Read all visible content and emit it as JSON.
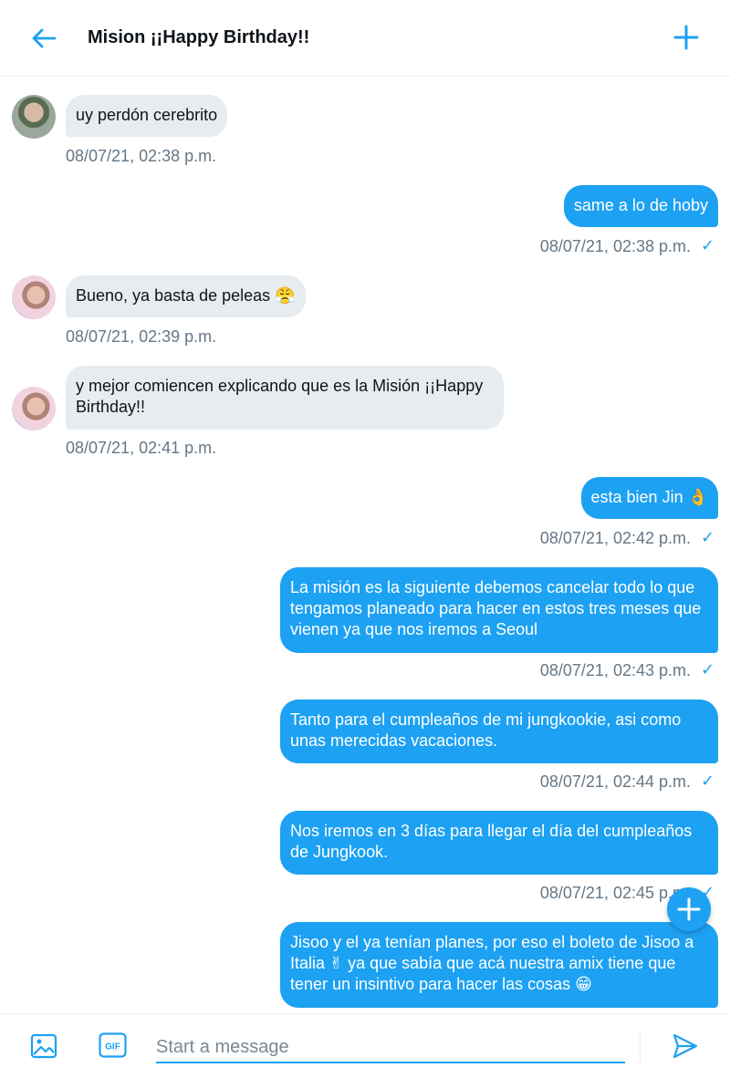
{
  "header": {
    "title": "Mision ¡¡Happy Birthday!!"
  },
  "messages": [
    {
      "text": "uy perdón cerebrito",
      "time": "08/07/21, 02:38 p.m."
    },
    {
      "text": "same a lo de hoby",
      "time": "08/07/21, 02:38 p.m."
    },
    {
      "text": "Bueno, ya basta de peleas 😤",
      "time": "08/07/21, 02:39 p.m."
    },
    {
      "text": "y mejor comiencen explicando que es la Misión ¡¡Happy Birthday!!",
      "time": "08/07/21, 02:41 p.m."
    },
    {
      "text": "esta bien Jin 👌",
      "time": "08/07/21, 02:42 p.m."
    },
    {
      "text": "La misión es la siguiente debemos cancelar todo lo que tengamos planeado para hacer en estos tres meses que vienen ya que nos iremos a Seoul",
      "time": "08/07/21, 02:43 p.m."
    },
    {
      "text": "Tanto para el cumpleaños de mi jungkookie, asi como unas merecidas vacaciones.",
      "time": "08/07/21, 02:44 p.m."
    },
    {
      "text": "Nos iremos en 3 días para llegar el día del cumpleaños de Jungkook.",
      "time": "08/07/21, 02:45 p.m."
    },
    {
      "text": "Jisoo y el ya tenían planes, por eso el boleto de Jisoo a Italia ✌ ya que sabía que acá nuestra amix tiene que tener un insintivo  para hacer las cosas 😁"
    }
  ],
  "status": {
    "read_mark": "✓"
  },
  "composer": {
    "placeholder": "Start a message",
    "gif_label": "GIF"
  },
  "colors": {
    "accent": "#1da1f2",
    "incoming_bubble": "#e6ecf0",
    "timestamp": "#657786"
  },
  "icons": {
    "back": "back-arrow-icon",
    "add": "plus-icon",
    "fab": "plus-icon",
    "image": "image-icon",
    "gif": "gif-icon",
    "send": "send-icon"
  }
}
